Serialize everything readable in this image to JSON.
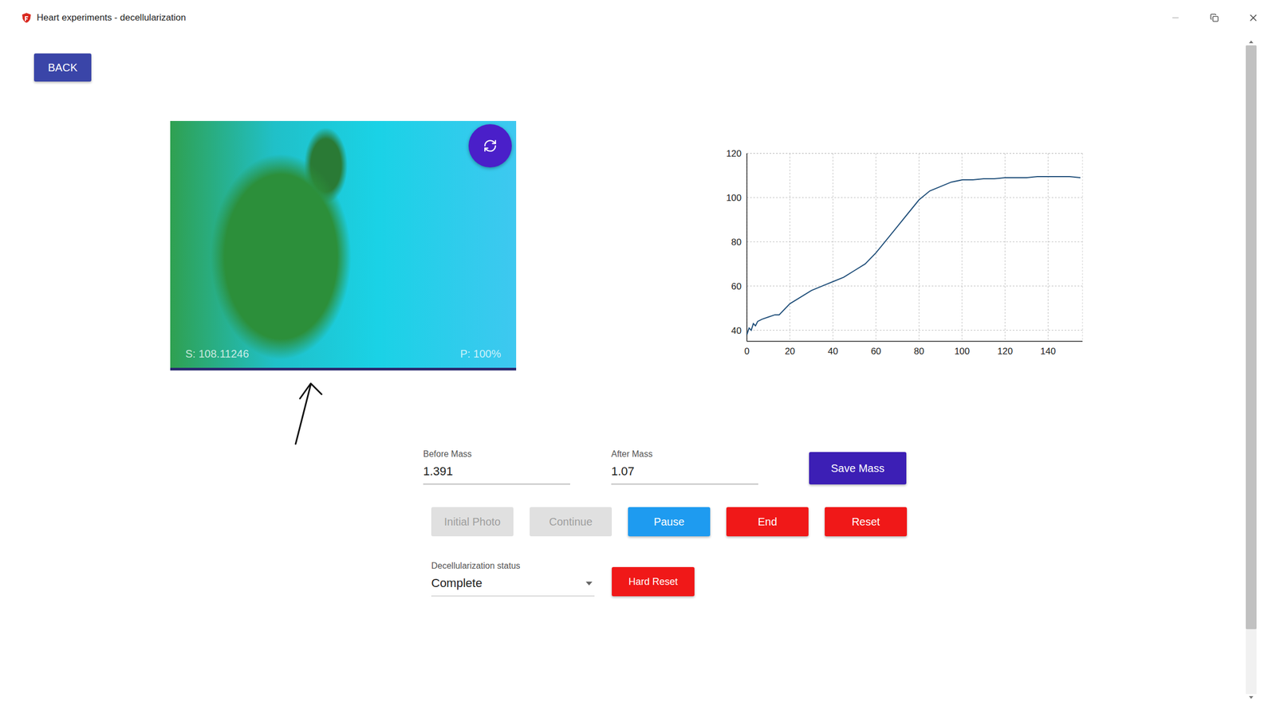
{
  "window": {
    "title": "Heart experiments - decellularization"
  },
  "back_button": {
    "label": "BACK"
  },
  "camera": {
    "score": "S: 108.11246",
    "progress": "P: 100%"
  },
  "chart": {
    "y_ticks": [
      "40",
      "60",
      "80",
      "100",
      "120"
    ],
    "x_ticks": [
      "0",
      "20",
      "40",
      "60",
      "80",
      "100",
      "120",
      "140"
    ],
    "series": [
      {
        "x": [
          0,
          1,
          2,
          3,
          4,
          5,
          7,
          10,
          13,
          15,
          20,
          25,
          30,
          35,
          40,
          45,
          50,
          55,
          60,
          65,
          70,
          75,
          80,
          85,
          90,
          95,
          100,
          105,
          110,
          115,
          120,
          125,
          130,
          135,
          140,
          145,
          150,
          155
        ],
        "y": [
          38,
          41,
          40,
          43,
          42,
          44,
          45,
          46,
          47,
          47,
          52,
          55,
          58,
          60,
          62,
          64,
          67,
          70,
          75,
          81,
          87,
          93,
          99,
          103,
          105,
          107,
          108,
          108,
          108.5,
          108.5,
          109,
          109,
          109,
          109.5,
          109.5,
          109.5,
          109.5,
          109
        ]
      }
    ]
  },
  "mass_fields": [
    {
      "label": "Before Mass",
      "value": "1.391"
    },
    {
      "label": "After Mass",
      "value": "1.07"
    }
  ],
  "save_button": {
    "label": "Save Mass"
  },
  "actions": [
    {
      "label": "Initial Photo",
      "disabled": true,
      "color": "#e0e0e0"
    },
    {
      "label": "Continue",
      "disabled": true,
      "color": "#e0e0e0"
    },
    {
      "label": "Pause",
      "disabled": false,
      "color": "#1e9bf0"
    },
    {
      "label": "End",
      "disabled": false,
      "color": "#f01818"
    },
    {
      "label": "Reset",
      "disabled": false,
      "color": "#f01818"
    }
  ],
  "status": {
    "label": "Decellularization status",
    "value": "Complete"
  },
  "hard_reset": {
    "label": "Hard Reset"
  },
  "scrollbar": {
    "level": 0.9
  }
}
